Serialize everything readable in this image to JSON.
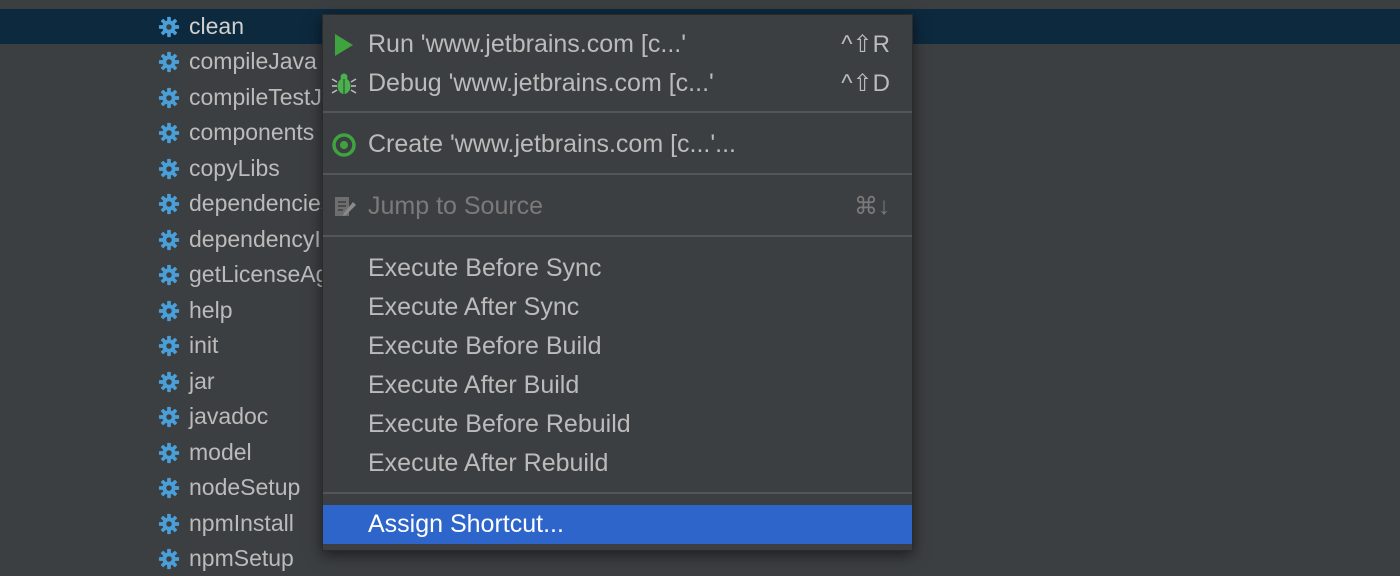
{
  "tree": {
    "items": [
      {
        "label": "clean",
        "selected": true
      },
      {
        "label": "compileJava"
      },
      {
        "label": "compileTestJava"
      },
      {
        "label": "components"
      },
      {
        "label": "copyLibs"
      },
      {
        "label": "dependencies"
      },
      {
        "label": "dependencyInsight"
      },
      {
        "label": "getLicenseAgreement"
      },
      {
        "label": "help"
      },
      {
        "label": "init"
      },
      {
        "label": "jar"
      },
      {
        "label": "javadoc"
      },
      {
        "label": "model"
      },
      {
        "label": "nodeSetup"
      },
      {
        "label": "npmInstall"
      },
      {
        "label": "npmSetup"
      }
    ]
  },
  "context_menu": {
    "run": {
      "label": "Run 'www.jetbrains.com [c...'",
      "shortcut": "^⇧R"
    },
    "debug": {
      "label": "Debug 'www.jetbrains.com [c...'",
      "shortcut": "^⇧D"
    },
    "create": {
      "label": "Create 'www.jetbrains.com [c...'..."
    },
    "jump": {
      "label": "Jump to Source",
      "shortcut": "⌘↓"
    },
    "execute_before_sync": {
      "label": "Execute Before Sync"
    },
    "execute_after_sync": {
      "label": "Execute After Sync"
    },
    "execute_before_build": {
      "label": "Execute Before Build"
    },
    "execute_after_build": {
      "label": "Execute After Build"
    },
    "execute_before_rebuild": {
      "label": "Execute Before Rebuild"
    },
    "execute_after_rebuild": {
      "label": "Execute After Rebuild"
    },
    "assign_shortcut": {
      "label": "Assign Shortcut..."
    }
  },
  "colors": {
    "background": "#3c3f41",
    "selected_row": "#0d293e",
    "menu_highlight": "#2e65ca",
    "gear_icon": "#4a9fd8",
    "run_icon": "#3fa33f"
  }
}
